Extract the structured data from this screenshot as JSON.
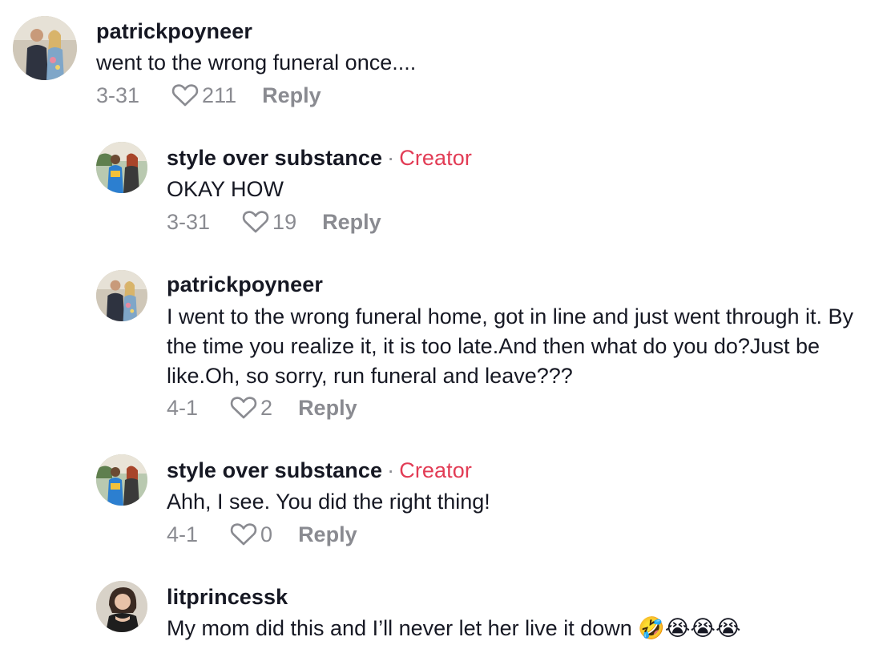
{
  "reply_label": "Reply",
  "creator_label": "Creator",
  "colors": {
    "creator": "#e23c55",
    "meta": "#8a8b91",
    "text": "#161823"
  },
  "comments": [
    {
      "username": "patrickpoyneer",
      "text": "went to the wrong funeral once....",
      "date": "3-31",
      "likes": "211",
      "is_creator": false,
      "avatar_icon": "couple-photo-avatar"
    },
    {
      "username": "style over substance",
      "text": "OKAY HOW",
      "date": "3-31",
      "likes": "19",
      "is_creator": true,
      "avatar_icon": "creator-photo-avatar"
    },
    {
      "username": "patrickpoyneer",
      "text": "I went to the wrong funeral home, got in line and just went through it. By the time you realize it, it is too late.And then what do you do?Just be like.Oh, so sorry, run funeral and leave???",
      "date": "4-1",
      "likes": "2",
      "is_creator": false,
      "avatar_icon": "couple-photo-avatar"
    },
    {
      "username": "style over substance",
      "text": "Ahh, I see. You did the right thing!",
      "date": "4-1",
      "likes": "0",
      "is_creator": true,
      "avatar_icon": "creator-photo-avatar"
    },
    {
      "username": "litprincessk",
      "text": "My mom did this and I’ll never let her live it down 🤣😭😭😭",
      "is_creator": false,
      "avatar_icon": "woman-photo-avatar"
    }
  ]
}
